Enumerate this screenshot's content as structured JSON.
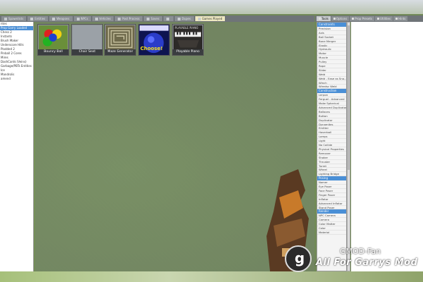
{
  "tabs": [
    {
      "label": "Spawnlists",
      "active": false
    },
    {
      "label": "Entities",
      "active": false
    },
    {
      "label": "Weapons",
      "active": false
    },
    {
      "label": "NPCs",
      "active": false
    },
    {
      "label": "Vehicles",
      "active": false
    },
    {
      "label": "Post Process",
      "active": false
    },
    {
      "label": "Saves",
      "active": false
    },
    {
      "label": "",
      "active": false
    },
    {
      "label": "Dupes",
      "active": false
    },
    {
      "label": "Games Played",
      "active": true
    }
  ],
  "left_list": [
    {
      "label": "ntes",
      "selected": false
    },
    {
      "label": "Prop Garry Loaded",
      "selected": true
    },
    {
      "label": "Chess 2",
      "selected": false
    },
    {
      "label": "Instants",
      "selected": false
    },
    {
      "label": "Brush Maker",
      "selected": false
    },
    {
      "label": "Underscore Hills",
      "selected": false
    },
    {
      "label": "Plodded 2",
      "selected": false
    },
    {
      "label": "Pinball 2 Cores",
      "selected": false
    },
    {
      "label": "Mires",
      "selected": false
    },
    {
      "label": "DashCards (Veins)",
      "selected": false
    },
    {
      "label": "Garbage/PBTs Entities",
      "selected": false
    },
    {
      "label": "Ice",
      "selected": false
    },
    {
      "label": "Mandrolis",
      "selected": false
    },
    {
      "label": "amend",
      "selected": false
    }
  ],
  "thumbnails": [
    {
      "caption": "Bouncy Ball"
    },
    {
      "caption": "Chair Seat"
    },
    {
      "caption": "Maze Generator"
    },
    {
      "caption": "",
      "banner": "Choose!"
    },
    {
      "caption": "Playable Piano",
      "banner": "PLAYABLE PIANO"
    }
  ],
  "right_tabs": [
    {
      "label": "Tools",
      "active": true
    },
    {
      "label": "Options",
      "active": false
    },
    {
      "label": "Prop Presets",
      "active": false
    },
    {
      "label": "Utilities",
      "active": false
    },
    {
      "label": "Hints",
      "active": false
    }
  ],
  "tool_groups": [
    {
      "header": "Constraints",
      "items": [
        "Precision",
        "Axis",
        "Ball Socket",
        "Bone Merger",
        "Elastic",
        "Hydraulic",
        "Motor",
        "Muscle",
        "Pulley",
        "Rope",
        "Slider",
        "Weld",
        "Weld - Ease as Sna...",
        "Winch",
        "Wiredsc Weld"
      ]
    },
    {
      "header": "Construction",
      "items": [
        "Lerpon",
        "Ferguel - Advanced",
        "Make Spherical",
        "Advanced Duplicator",
        "Balloons",
        "Button",
        "Duplicator",
        "Dynamites",
        "Emitter",
        "Hoverball",
        "Lamps",
        "Light",
        "No Collide",
        "Physical Properties",
        "Remover",
        "Shaker",
        "Thruster",
        "Turret",
        "Wheel",
        "Lighting Bridge"
      ]
    },
    {
      "header": "Posing",
      "items": [
        "Nomer",
        "Eye Poser",
        "Face Poser",
        "Finger Poser",
        "Inflator",
        "Advanced Inflator",
        "Stand Poser"
      ]
    },
    {
      "header": "Render",
      "items": [
        "NPC Camera",
        "Camera",
        "Color Matter",
        "Color",
        "Material"
      ]
    }
  ],
  "watermark": {
    "title": "GMOD-Fan",
    "subtitle": "All For Garrys Mod",
    "icon_letter": "g"
  },
  "colors": {
    "accent": "#4a8fd6",
    "active_tab": "#eee9c0"
  }
}
